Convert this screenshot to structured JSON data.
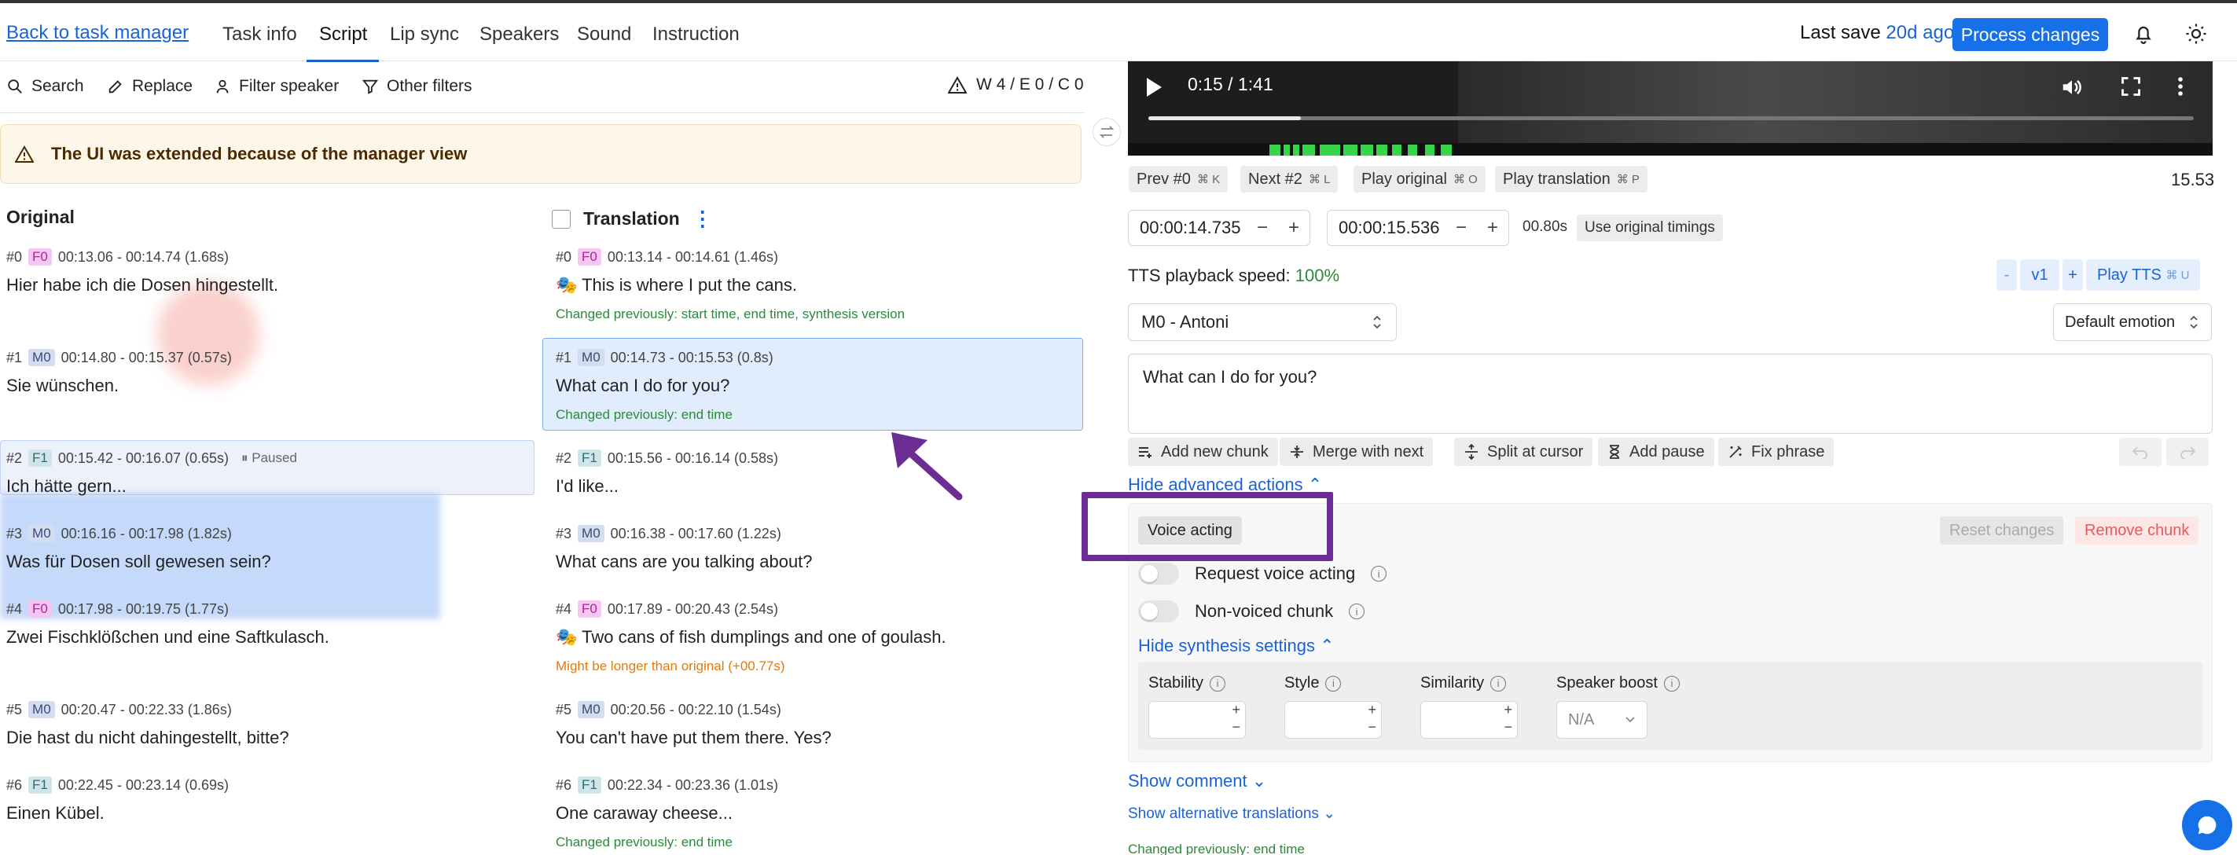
{
  "nav": {
    "back_link": "Back to task manager",
    "tabs": [
      "Task info",
      "Script",
      "Lip sync",
      "Speakers",
      "Sound",
      "Instruction"
    ],
    "active_tab": "Script",
    "last_save_label": "Last save",
    "last_save_ago": "20d ago",
    "process_button": "Process changes"
  },
  "toolbar": {
    "search": "Search",
    "replace": "Replace",
    "filter_speaker": "Filter speaker",
    "other_filters": "Other filters",
    "counts": "W 4 / E 0 / C 0"
  },
  "banner": "The UI was extended because of the manager view",
  "original": {
    "header": "Original",
    "segments": [
      {
        "id": "#0",
        "speaker": "F0",
        "time": "00:13.06 - 00:14.74 (1.68s)",
        "text": "Hier habe ich die Dosen hingestellt."
      },
      {
        "id": "#1",
        "speaker": "M0",
        "time": "00:14.80 - 00:15.37 (0.57s)",
        "text": "Sie wünschen."
      },
      {
        "id": "#2",
        "speaker": "F1",
        "time": "00:15.42 - 00:16.07 (0.65s)",
        "text": "Ich hätte gern...",
        "paused": "⏸ Paused"
      },
      {
        "id": "#3",
        "speaker": "M0",
        "time": "00:16.16 - 00:17.98 (1.82s)",
        "text": "Was für Dosen soll gewesen sein?"
      },
      {
        "id": "#4",
        "speaker": "F0",
        "time": "00:17.98 - 00:19.75 (1.77s)",
        "text": "Zwei Fischklößchen und eine Saftkulasch."
      },
      {
        "id": "#5",
        "speaker": "M0",
        "time": "00:20.47 - 00:22.33 (1.86s)",
        "text": "Die hast du nicht dahingestellt, bitte?"
      },
      {
        "id": "#6",
        "speaker": "F1",
        "time": "00:22.45 - 00:23.14 (0.69s)",
        "text": "Einen Kübel."
      }
    ]
  },
  "translation": {
    "header": "Translation",
    "segments": [
      {
        "id": "#0",
        "speaker": "F0",
        "time": "00:13.14 - 00:14.61 (1.46s)",
        "text": "🎭 This is where I put the cans.",
        "note": "Changed previously: start time, end time, synthesis version",
        "note_type": "green"
      },
      {
        "id": "#1",
        "speaker": "M0",
        "time": "00:14.73 - 00:15.53 (0.8s)",
        "text": "What can I do for you?",
        "note": "Changed previously: end time",
        "note_type": "green"
      },
      {
        "id": "#2",
        "speaker": "F1",
        "time": "00:15.56 - 00:16.14 (0.58s)",
        "text": "I'd like...",
        "note": "",
        "note_type": ""
      },
      {
        "id": "#3",
        "speaker": "M0",
        "time": "00:16.38 - 00:17.60 (1.22s)",
        "text": "What cans are you talking about?",
        "note": "",
        "note_type": ""
      },
      {
        "id": "#4",
        "speaker": "F0",
        "time": "00:17.89 - 00:20.43 (2.54s)",
        "text": "🎭 Two cans of fish dumplings and one of goulash.",
        "note": "Might be longer than original (+00.77s)",
        "note_type": "orange"
      },
      {
        "id": "#5",
        "speaker": "M0",
        "time": "00:20.56 - 00:22.10 (1.54s)",
        "text": "You can't have put them there. Yes?",
        "note": "",
        "note_type": ""
      },
      {
        "id": "#6",
        "speaker": "F1",
        "time": "00:22.34 - 00:23.36 (1.01s)",
        "text": "One caraway cheese...",
        "note": "Changed previously: end time",
        "note_type": "green"
      }
    ]
  },
  "player": {
    "time": "0:15 / 1:41",
    "progress": 0.146
  },
  "segment_nav": {
    "prev": "Prev #0",
    "prev_kbd": "⌘ K",
    "next": "Next #2",
    "next_kbd": "⌘ L",
    "play_original": "Play original",
    "play_original_kbd": "⌘ O",
    "play_translation": "Play translation",
    "play_translation_kbd": "⌘ P",
    "duration": "15.53"
  },
  "timing": {
    "start": "00:00:14.735",
    "end": "00:00:15.536",
    "length": "00.80s",
    "use_original": "Use original timings"
  },
  "tts": {
    "speed_label": "TTS playback speed:",
    "speed_value": "100%",
    "minus": "-",
    "version": "v1",
    "plus": "+",
    "play": "Play TTS",
    "play_kbd": "⌘ U"
  },
  "speaker_select": "M0 - Antoni",
  "emotion_select": "Default emotion",
  "text_value": "What can I do for you?",
  "actions": {
    "add_chunk": "Add new chunk",
    "merge": "Merge with next",
    "split": "Split at cursor",
    "add_pause": "Add pause",
    "fix_phrase": "Fix phrase"
  },
  "advanced": {
    "hide_label": "Hide advanced actions",
    "voice_acting": "Voice acting",
    "reset": "Reset changes",
    "remove": "Remove chunk",
    "request_voice_acting": "Request voice acting",
    "non_voiced": "Non-voiced chunk",
    "hide_synth": "Hide synthesis settings",
    "stability": "Stability",
    "style": "Style",
    "similarity": "Similarity",
    "speaker_boost": "Speaker boost",
    "boost_value": "N/A"
  },
  "footer": {
    "show_comment": "Show comment",
    "show_alt": "Show alternative translations",
    "changed_prev": "Changed previously: end time"
  },
  "colors": {
    "accent": "#1670e8",
    "annotation": "#6b2d93",
    "selected_bg": "#e1ecfd",
    "changed_green": "#2c8a3a",
    "warning_orange": "#e07b10"
  }
}
